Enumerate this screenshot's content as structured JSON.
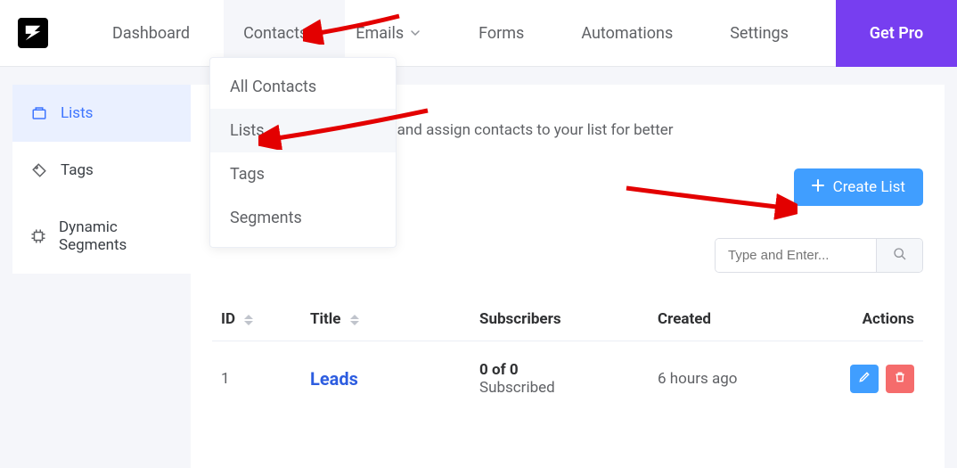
{
  "nav": {
    "dashboard": "Dashboard",
    "contacts": "Contacts",
    "emails": "Emails",
    "forms": "Forms",
    "automations": "Automations",
    "settings": "Settings",
    "get_pro": "Get Pro"
  },
  "dropdown": {
    "all_contacts": "All Contacts",
    "lists": "Lists",
    "tags": "Tags",
    "segments": "Segments"
  },
  "sidebar": {
    "lists": "Lists",
    "tags": "Tags",
    "dynamic_segments": "Dynamic Segments"
  },
  "main": {
    "description": "contacts. You can add lists and assign contacts to your list for better",
    "create_btn": "Create List",
    "search_placeholder": "Type and Enter..."
  },
  "table": {
    "headers": {
      "id": "ID",
      "title": "Title",
      "subscribers": "Subscribers",
      "created": "Created",
      "actions": "Actions"
    },
    "rows": [
      {
        "id": "1",
        "title": "Leads",
        "sub_line1": "0 of 0",
        "sub_line2": "Subscribed",
        "created": "6 hours ago"
      }
    ]
  }
}
